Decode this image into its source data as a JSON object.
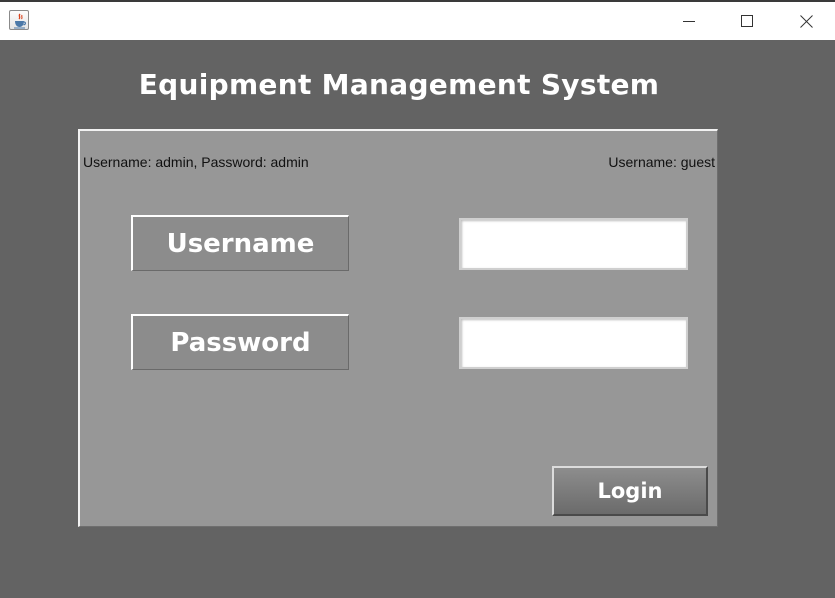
{
  "window": {
    "icon": "java-cup-icon",
    "controls": [
      "minimize-icon",
      "maximize-icon",
      "close-icon"
    ]
  },
  "app": {
    "title": "Equipment Management System"
  },
  "login_panel": {
    "hint_admin": "Username: admin, Password: admin",
    "hint_guest": "Username: guest",
    "username_label": "Username",
    "password_label": "Password",
    "username_value": "",
    "password_value": "",
    "login_button": "Login"
  },
  "colors": {
    "background": "#636363",
    "panel": "#979797",
    "title_text": "#ffffff"
  }
}
